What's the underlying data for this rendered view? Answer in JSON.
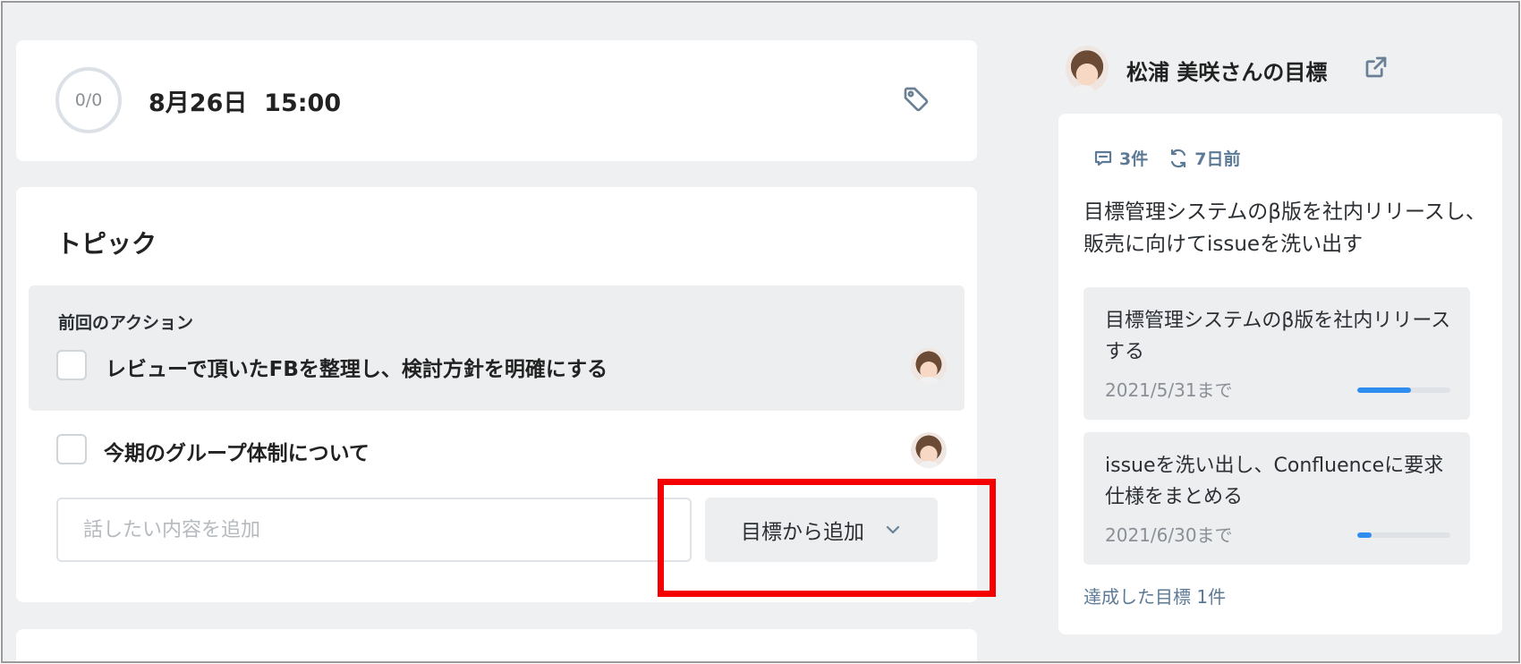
{
  "header": {
    "progress_text": "0/0",
    "datetime": "8月26日  15:00",
    "tag_icon": "tag-icon"
  },
  "topic": {
    "title": "トピック",
    "previous_actions_label": "前回のアクション",
    "items": [
      {
        "label": "レビューで頂いたFBを整理し、検討方針を明確にする",
        "checked": false
      },
      {
        "label": "今期のグループ体制について",
        "checked": false
      }
    ],
    "add_placeholder": "話したい内容を追加",
    "add_from_goal_label": "目標から追加"
  },
  "goals_panel": {
    "owner_title": "松浦 美咲さんの目標",
    "comments_count": "3件",
    "updated": "7日前",
    "description": "目標管理システムのβ版を社内リリースし、販売に向けてissueを洗い出す",
    "sub_goals": [
      {
        "title": "目標管理システムのβ版を社内リリースする",
        "due": "2021/5/31まで",
        "progress": 0.58
      },
      {
        "title": "issueを洗い出し、Confluenceに要求仕様をまとめる",
        "due": "2021/6/30まで",
        "progress": 0.15
      }
    ],
    "achieved_link": "達成した目標 1件"
  },
  "colors": {
    "highlight": "#f50000",
    "accent": "#2f8df0",
    "link": "#5c7a96",
    "background": "#eef0f2"
  }
}
